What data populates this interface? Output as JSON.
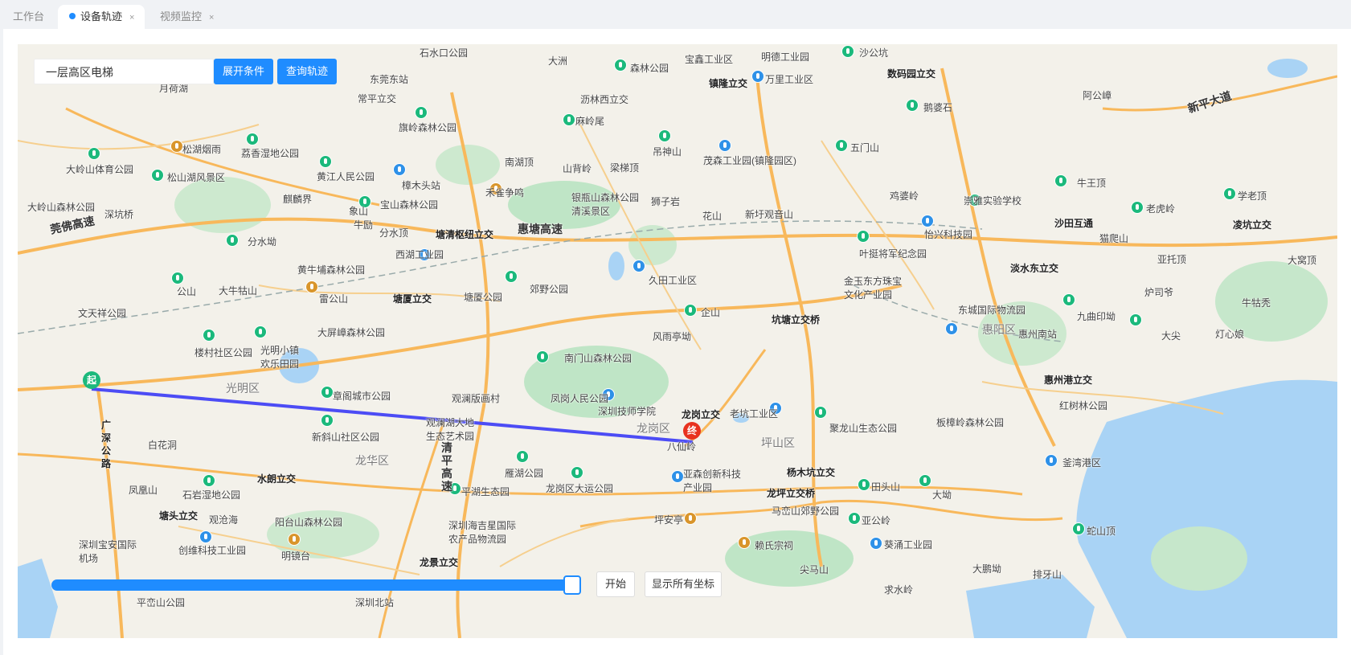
{
  "tabs": [
    {
      "label": "工作台",
      "active": false
    },
    {
      "label": "设备轨迹",
      "active": true
    },
    {
      "label": "视频监控",
      "active": false
    }
  ],
  "tab_close_glyph": "×",
  "toolbar": {
    "device_value": "一层高区电梯",
    "expand_label": "展开条件",
    "query_label": "查询轨迹"
  },
  "track": {
    "start_label": "起",
    "end_label": "终",
    "line_color": "#4c4cf5",
    "playback_progress": 1.0
  },
  "controls": {
    "start_label": "开始",
    "show_all_label": "显示所有坐标"
  },
  "map_labels": {
    "districts": [
      "光明区",
      "龙华区",
      "龙岗区",
      "坪山区",
      "惠阳区"
    ],
    "expressways": [
      "莞佛高速",
      "惠塘高速",
      "清平高速",
      "新平大道"
    ],
    "places": [
      "月荷湖",
      "常平立交",
      "东莞东站",
      "石水口公园",
      "大洲",
      "森林公园",
      "宝鑫工业区",
      "明德工业园",
      "沙公坑",
      "镇隆立交",
      "万里工业区",
      "数码园立交",
      "新平大道",
      "旗岭森林公园",
      "沥林西立交",
      "麻岭尾",
      "吊神山",
      "茂森工业园(镇隆园区)",
      "五门山",
      "鹅婆石",
      "阿公嶂",
      "松湖烟雨",
      "荔香湿地公园",
      "大岭山体育公园",
      "松山湖风景区",
      "黄江人民公园",
      "南湖顶",
      "山背岭",
      "梁梯顶",
      "大岭山森林公园",
      "深坑桥",
      "麒麟界",
      "象山",
      "宝山森林公园",
      "樟木头站",
      "禾雀争鸣",
      "银瓶山森林公园清溪景区",
      "狮子岩",
      "花山",
      "新圩观音山",
      "鸡婆岭",
      "崇雅实验学校",
      "牛王顶",
      "老虎岭",
      "学老顶",
      "分水坳",
      "牛励",
      "分水顶",
      "塘清枢纽立交",
      "怡兴科技园",
      "叶挺将军纪念园",
      "沙田互通",
      "猫爬山",
      "凌坑立交",
      "黄牛埔森林公园",
      "西湖工业园",
      "郊野公园",
      "久田工业区",
      "金玉东方珠宝文化产业园",
      "淡水东立交",
      "亚托顶",
      "大窝顶",
      "雷公山",
      "公山",
      "大牛牯山",
      "塘厦立交",
      "塘厦公园",
      "企山",
      "坑塘立交桥",
      "九曲印坳",
      "炉司爷",
      "牛牯秃",
      "文天祥公园",
      "大屏嶂森林公园",
      "风雨亭坳",
      "东城国际物流园",
      "惠州南站",
      "大尖",
      "灯心娘",
      "楼村社区公园",
      "光明小镇欢乐田园",
      "南门山森林公园",
      "惠州港立交",
      "章阁城市公园",
      "观澜版画村",
      "凤岗人民公园",
      "深圳技师学院",
      "龙岗立交",
      "老坑工业区",
      "板樟岭森林公园",
      "红树林公园",
      "新斜山社区公园",
      "观澜湖大地生态艺术园",
      "八仙岭",
      "聚龙山生态公园",
      "白花洞",
      "广深公路",
      "凤凰山",
      "石岩湿地公园",
      "水朗立交",
      "雁湖公园",
      "平湖生态园",
      "龙岗区大运公园",
      "亚森创新科技产业园",
      "杨木坑立交",
      "田头山",
      "大坳",
      "釜湾港区",
      "塘头立交",
      "观沧海",
      "阳台山森林公园",
      "深圳海吉星国际农产品物流园",
      "坪安亭",
      "龙坪立交桥",
      "马峦山郊野公园",
      "亚公岭",
      "葵涌工业园",
      "蛇山顶",
      "深圳宝安国际机场",
      "创维科技工业园",
      "明镜台",
      "赖氏宗祠",
      "尖马山",
      "大鹏坳",
      "排牙山",
      "平峦山公园",
      "深圳北站",
      "龙景立交",
      "求水岭"
    ]
  },
  "icons": {
    "poi_park": "tree-icon",
    "poi_building": "building-icon",
    "poi_culture": "temple-icon"
  }
}
